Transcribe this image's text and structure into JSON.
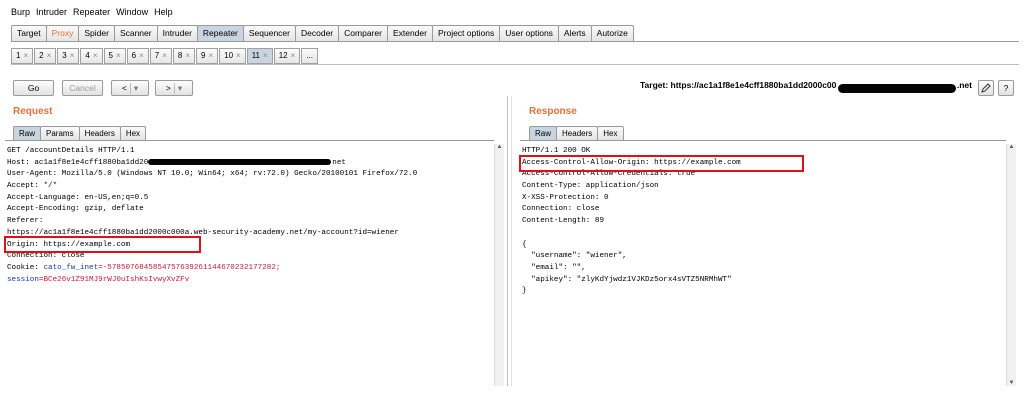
{
  "menu": [
    "Burp",
    "Intruder",
    "Repeater",
    "Window",
    "Help"
  ],
  "main_tabs": [
    {
      "label": "Target",
      "state": ""
    },
    {
      "label": "Proxy",
      "state": "proxy"
    },
    {
      "label": "Spider",
      "state": ""
    },
    {
      "label": "Scanner",
      "state": ""
    },
    {
      "label": "Intruder",
      "state": ""
    },
    {
      "label": "Repeater",
      "state": "active"
    },
    {
      "label": "Sequencer",
      "state": ""
    },
    {
      "label": "Decoder",
      "state": ""
    },
    {
      "label": "Comparer",
      "state": ""
    },
    {
      "label": "Extender",
      "state": ""
    },
    {
      "label": "Project options",
      "state": ""
    },
    {
      "label": "User options",
      "state": ""
    },
    {
      "label": "Alerts",
      "state": ""
    },
    {
      "label": "Autorize",
      "state": ""
    }
  ],
  "repeater_tabs": [
    "1",
    "2",
    "3",
    "4",
    "5",
    "6",
    "7",
    "8",
    "9",
    "10",
    "11",
    "12"
  ],
  "repeater_active_tab": "11",
  "repeater_more_label": "...",
  "tab_close_glyph": "×",
  "toolbar": {
    "go_label": "Go",
    "cancel_label": "Cancel",
    "back_label": "<",
    "forward_label": ">",
    "dropdown_glyph": "▾",
    "target_label": "Target: https://ac1a1f8e1e4cff1880ba1dd2000c00",
    "target_suffix": ".net",
    "edit_icon": "pencil-icon",
    "help_label": "?"
  },
  "request": {
    "title": "Request",
    "tabs": [
      "Raw",
      "Params",
      "Headers",
      "Hex"
    ],
    "active_tab": "Raw",
    "lines": [
      "GET /accountDetails HTTP/1.1",
      "Host: ac1a1f8e1e4cff1880ba1dd20",
      "User-Agent: Mozilla/5.0 (Windows NT 10.0; Win64; x64; rv:72.0) Gecko/20100101 Firefox/72.0",
      "Accept: */*",
      "Accept-Language: en-US,en;q=0.5",
      "Accept-Encoding: gzip, deflate",
      "Referer:",
      "https://ac1a1f8e1e4cff1880ba1dd2000c000a.web-security-academy.net/my-account?id=wiener",
      "Origin: https://example.com",
      "Connection: close"
    ],
    "host_suffix": "net",
    "cookie_label": "Cookie: ",
    "cookie_name": "cato_fw_inet",
    "cookie_value": "=-57850768458547576392611446702321772​82;",
    "session_name": "session",
    "session_value": "=BCe26v1Z91MJ9rWJ0uIshKsIvwyXvZFv"
  },
  "response": {
    "title": "Response",
    "tabs": [
      "Raw",
      "Headers",
      "Hex"
    ],
    "active_tab": "Raw",
    "lines": [
      "HTTP/1.1 200 OK",
      "Access-Control-Allow-Origin: https://example.com",
      "Access-Control-Allow-Credentials: true",
      "Content-Type: application/json",
      "X-XSS-Protection: 0",
      "Connection: close",
      "Content-Length: 89",
      "",
      "{",
      "  \"username\": \"wiener\",",
      "  \"email\": \"\",",
      "  \"apikey\": \"zlyKdYjwdz1VJKDz5orx4sVTZ5NRMhWT\"",
      "}"
    ]
  },
  "scroll_up_glyph": "▲",
  "scroll_down_glyph": "▼",
  "colors": {
    "accent_orange": "#e2703a",
    "highlight_red": "#e0101a",
    "cookie_blue": "#1e3aa8",
    "cookie_red": "#c8193a"
  }
}
